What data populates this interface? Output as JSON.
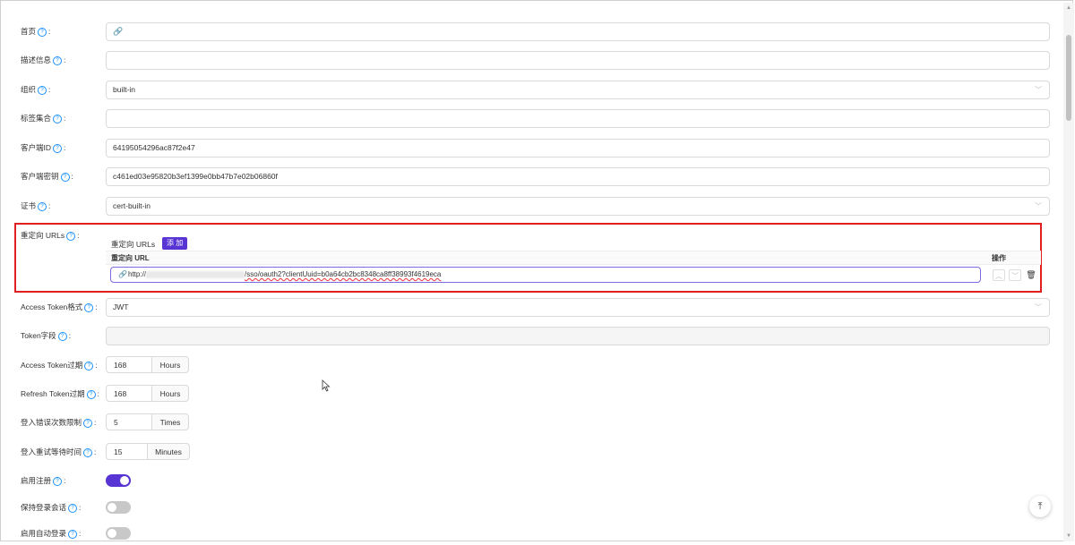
{
  "form": {
    "homepage": {
      "label": "首页",
      "value": "",
      "icon": "link-icon"
    },
    "description": {
      "label": "描述信息",
      "value": ""
    },
    "organization": {
      "label": "组织",
      "value": "built-in"
    },
    "tags": {
      "label": "标签集合",
      "value": ""
    },
    "client_id": {
      "label": "客户端ID",
      "value": "64195054296ac87f2e47"
    },
    "client_secret": {
      "label": "客户端密钥",
      "value": "c461ed03e95820b3ef1399e0bb47b7e02b06860f"
    },
    "cert": {
      "label": "证书",
      "value": "cert-built-in"
    },
    "redirect": {
      "label": "重定向 URLs",
      "section_title": "重定向 URLs",
      "add_button": "添 加",
      "col_url": "重定向 URL",
      "col_action": "操作",
      "url_prefix": "http://",
      "url_suffix": "/sso/oauth2?clientUuid=b0a64cb2bc8348ca8ff38993f4619eca"
    },
    "token_format": {
      "label": "Access Token格式",
      "value": "JWT"
    },
    "token_fields": {
      "label": "Token字段",
      "value": ""
    },
    "access_expire": {
      "label": "Access Token过期",
      "value": "168",
      "unit": "Hours"
    },
    "refresh_expire": {
      "label": "Refresh Token过期",
      "value": "168",
      "unit": "Hours"
    },
    "login_fail_limit": {
      "label": "登入错误次数限制",
      "value": "5",
      "unit": "Times"
    },
    "login_retry_wait": {
      "label": "登入重试等待时间",
      "value": "15",
      "unit": "Minutes"
    },
    "enable_signup": {
      "label": "启用注册",
      "on": true
    },
    "keep_session": {
      "label": "保持登录会话",
      "on": false
    },
    "auto_signin": {
      "label": "启用自动登录",
      "on": false
    }
  },
  "colors": {
    "accent": "#5734d3",
    "highlight_box": "#e02020",
    "help_icon": "#1890ff"
  }
}
